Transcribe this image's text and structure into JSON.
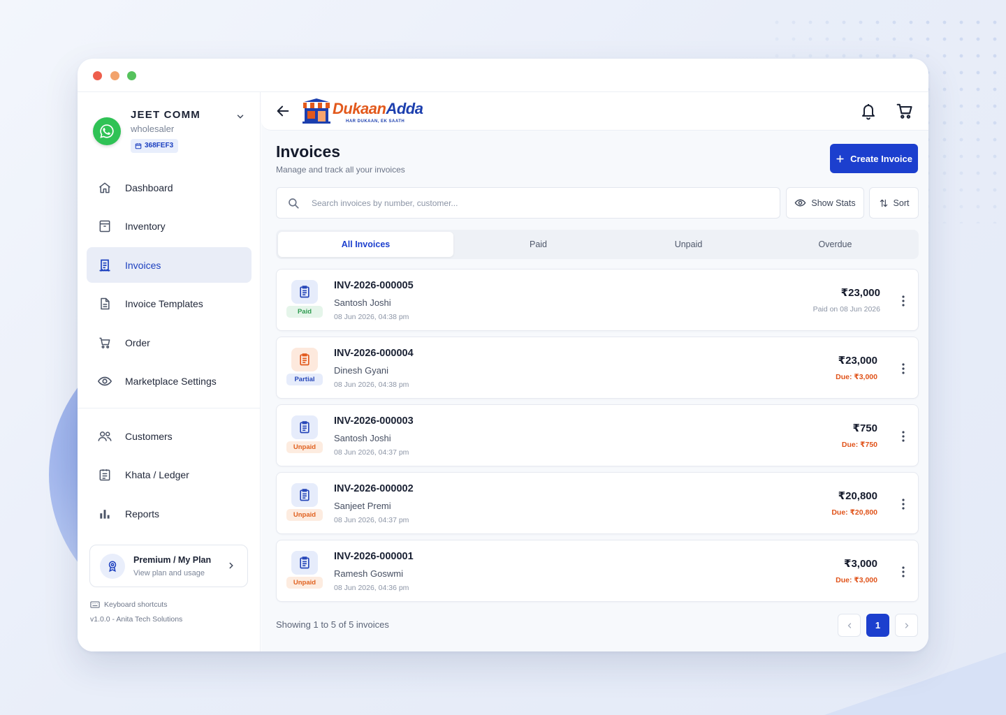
{
  "colors": {
    "accent": "#1c3fce",
    "paid": "#2e9b4f",
    "unpaid": "#e0611f",
    "due": "#e0531a",
    "whatsapp": "#2fc255"
  },
  "account": {
    "name": "JEET COMM",
    "type": "wholesaler",
    "code": "368FEF3",
    "avatar_icon": "whatsapp-icon"
  },
  "sidebar": {
    "primary": [
      {
        "label": "Dashboard",
        "icon": "home-icon",
        "active": false
      },
      {
        "label": "Inventory",
        "icon": "archive-icon",
        "active": false
      },
      {
        "label": "Invoices",
        "icon": "receipt-icon",
        "active": true
      },
      {
        "label": "Invoice Templates",
        "icon": "document-icon",
        "active": false
      },
      {
        "label": "Order",
        "icon": "cart-icon",
        "active": false
      },
      {
        "label": "Marketplace Settings",
        "icon": "eye-icon",
        "active": false
      }
    ],
    "secondary": [
      {
        "label": "Customers",
        "icon": "users-icon"
      },
      {
        "label": "Khata / Ledger",
        "icon": "ledger-icon"
      },
      {
        "label": "Reports",
        "icon": "bar-chart-icon"
      }
    ],
    "plan": {
      "title": "Premium / My Plan",
      "subtitle": "View plan and usage"
    },
    "shortcuts_label": "Keyboard shortcuts",
    "version": "v1.0.0 - Anita Tech Solutions"
  },
  "header": {
    "logo_part1": "Dukaan",
    "logo_part2": "Adda",
    "logo_tagline": "HAR DUKAAN, EK SAATH"
  },
  "page": {
    "title": "Invoices",
    "subtitle": "Manage and track all your invoices",
    "create_label": "Create Invoice",
    "search_placeholder": "Search invoices by number, customer...",
    "show_stats_label": "Show Stats",
    "sort_label": "Sort"
  },
  "tabs": [
    {
      "label": "All Invoices",
      "active": true
    },
    {
      "label": "Paid",
      "active": false
    },
    {
      "label": "Unpaid",
      "active": false
    },
    {
      "label": "Overdue",
      "active": false
    }
  ],
  "invoices": [
    {
      "number": "INV-2026-000005",
      "customer": "Santosh Joshi",
      "date": "08 Jun 2026, 04:38 pm",
      "amount": "₹23,000",
      "status": "Paid",
      "status_line": "Paid on 08 Jun 2026"
    },
    {
      "number": "INV-2026-000004",
      "customer": "Dinesh Gyani",
      "date": "08 Jun 2026, 04:38 pm",
      "amount": "₹23,000",
      "status": "Partial",
      "status_line": "Due: ₹3,000"
    },
    {
      "number": "INV-2026-000003",
      "customer": "Santosh Joshi",
      "date": "08 Jun 2026, 04:37 pm",
      "amount": "₹750",
      "status": "Unpaid",
      "status_line": "Due: ₹750"
    },
    {
      "number": "INV-2026-000002",
      "customer": "Sanjeet Premi",
      "date": "08 Jun 2026, 04:37 pm",
      "amount": "₹20,800",
      "status": "Unpaid",
      "status_line": "Due: ₹20,800"
    },
    {
      "number": "INV-2026-000001",
      "customer": "Ramesh Goswmi",
      "date": "08 Jun 2026, 04:36 pm",
      "amount": "₹3,000",
      "status": "Unpaid",
      "status_line": "Due: ₹3,000"
    }
  ],
  "pagination": {
    "summary": "Showing 1 to 5 of 5 invoices",
    "current_page": "1"
  }
}
